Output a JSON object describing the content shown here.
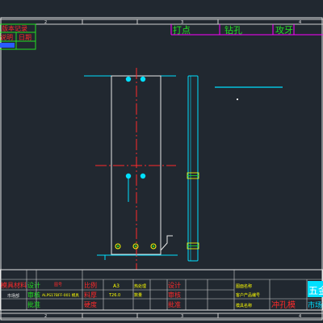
{
  "colors": {
    "background": "#212830",
    "frame": "#e8e8e8",
    "grid": "#cfcfcf",
    "red": "#ff2a2a",
    "green": "#22e022",
    "yellow": "#ffff00",
    "cyan": "#00e0ff",
    "magenta": "#ff00ff",
    "blue": "#2a5cff",
    "white": "#ffffff"
  },
  "top_ruler": {
    "labels": [
      "2",
      "3",
      "4"
    ]
  },
  "revision_block": {
    "title": "版本记录",
    "col_desc": "说明",
    "col_date": "日期"
  },
  "process_legend": {
    "labels": [
      "打点",
      "钻孔",
      "攻牙"
    ]
  },
  "bottom_ruler": {
    "labels": [
      "2",
      "3",
      "4"
    ]
  },
  "title_block": {
    "material_label": "模具材料",
    "designer_label": "设计",
    "reviewer_label": "审核",
    "approver_label": "批准",
    "drawing_no_label": "图号",
    "part_no": "ALPS17BFF-001 模具",
    "scale_value": "A3",
    "scale_label": "比例",
    "thickness_label": "料厚",
    "thickness_value": "T26.0",
    "hardness_label": "硬度",
    "heat_label": "热处理",
    "qty_label": "数量",
    "project_label": "图面名称",
    "mold_label": "模具名称",
    "customer_label": "客户产品编号",
    "mold_name_value": "冲孔模",
    "company": "五金",
    "company_sub": "市场部"
  }
}
